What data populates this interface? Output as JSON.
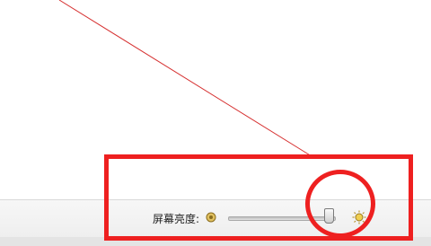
{
  "status_bar": {
    "brightness_label": "屏幕亮度:",
    "brightness_level": 0.95,
    "icons": {
      "dim": "brightness-low-icon",
      "bright": "brightness-high-icon"
    }
  },
  "annotation": {
    "color": "#ee2020",
    "shapes": [
      "rectangle",
      "circle",
      "line"
    ]
  }
}
